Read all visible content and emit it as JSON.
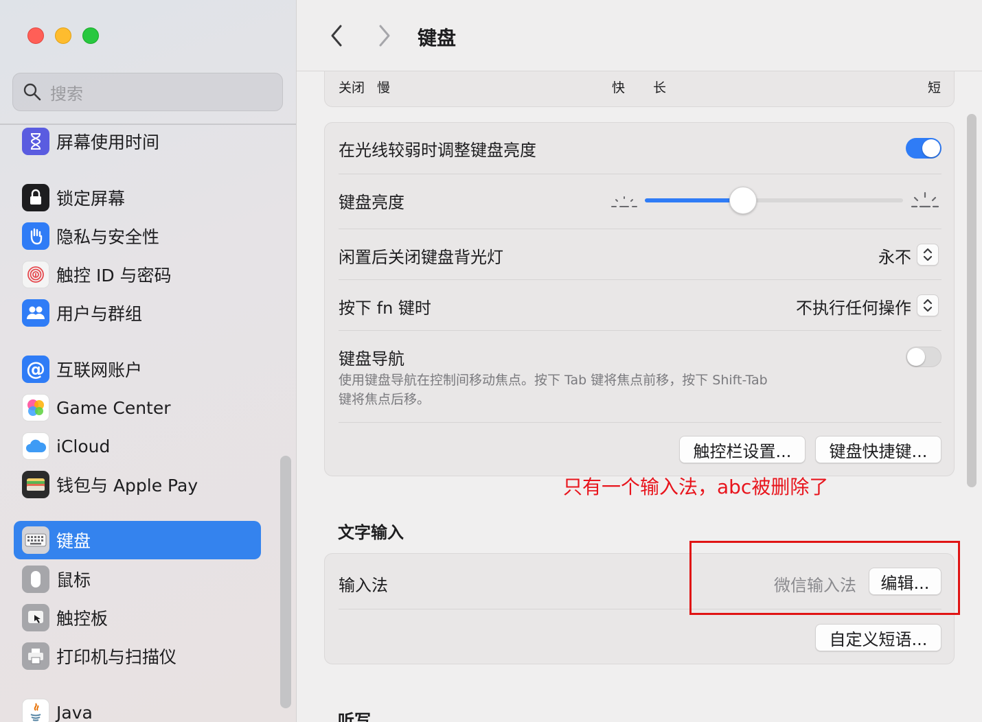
{
  "window": {
    "traffic_lights": {
      "close": "#ff5f57",
      "minimize": "#febc2e",
      "maximize": "#28c840"
    }
  },
  "sidebar": {
    "search_placeholder": "搜索",
    "items": [
      {
        "label": "屏幕使用时间",
        "icon": "hourglass-icon",
        "color": "#5a5ce0"
      },
      {
        "label": "锁定屏幕",
        "icon": "lock-icon",
        "color": "#1d1d1f"
      },
      {
        "label": "隐私与安全性",
        "icon": "hand-icon",
        "color": "#2f7cf6"
      },
      {
        "label": "触控 ID 与密码",
        "icon": "fingerprint-icon",
        "color": "#f2f2f2"
      },
      {
        "label": "用户与群组",
        "icon": "users-icon",
        "color": "#2f7cf6"
      },
      {
        "label": "互联网账户",
        "icon": "at-icon",
        "color": "#2f7cf6"
      },
      {
        "label": "Game Center",
        "icon": "game-center-icon",
        "color": "#ffffff"
      },
      {
        "label": "iCloud",
        "icon": "cloud-icon",
        "color": "#ffffff"
      },
      {
        "label": "钱包与 Apple Pay",
        "icon": "wallet-icon",
        "color": "#2b2b2b"
      },
      {
        "label": "键盘",
        "icon": "keyboard-icon",
        "color": "#9a9a9e",
        "active": true
      },
      {
        "label": "鼠标",
        "icon": "mouse-icon",
        "color": "#9a9a9e"
      },
      {
        "label": "触控板",
        "icon": "trackpad-icon",
        "color": "#9a9a9e"
      },
      {
        "label": "打印机与扫描仪",
        "icon": "printer-icon",
        "color": "#9a9a9e"
      },
      {
        "label": "Java",
        "icon": "java-icon",
        "color": "#ffffff"
      }
    ]
  },
  "toolbar": {
    "title": "键盘",
    "back_icon": "chevron-left-icon",
    "forward_icon": "chevron-right-icon"
  },
  "repeat_card": {
    "labels": {
      "off": "关闭",
      "slow": "慢",
      "fast": "快",
      "long": "长",
      "short": "短"
    }
  },
  "keyboard_card": {
    "auto_brightness_label": "在光线较弱时调整键盘亮度",
    "auto_brightness_on": true,
    "brightness_label": "键盘亮度",
    "brightness_level": 0.38,
    "backlight_off_label": "闲置后关闭键盘背光灯",
    "backlight_off_value": "永不",
    "fn_label": "按下 fn 键时",
    "fn_value": "不执行任何操作",
    "nav_label": "键盘导航",
    "nav_desc_line1": "使用键盘导航在控制间移动焦点。按下 Tab 键将焦点前移，按下 Shift-Tab",
    "nav_desc_line2": "键将焦点后移。",
    "nav_on": false,
    "touchbar_button": "触控栏设置...",
    "shortcuts_button": "键盘快捷键..."
  },
  "annotation": {
    "text": "只有一个输入法，abc被删除了",
    "color": "#e8141c"
  },
  "text_input": {
    "section_title": "文字输入",
    "input_method_label": "输入法",
    "input_method_value": "微信输入法",
    "edit_button": "编辑...",
    "text_replacement_button": "自定义短语..."
  },
  "dictation": {
    "section_title": "听写"
  }
}
